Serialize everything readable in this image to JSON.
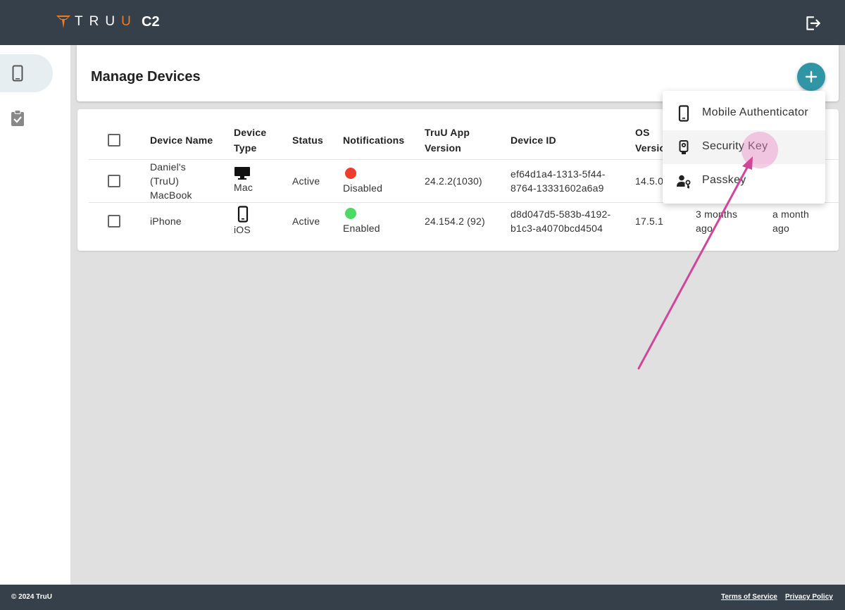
{
  "app": {
    "brand": "TRUU",
    "name": "C2"
  },
  "colors": {
    "topbar": "#36404a",
    "accent": "#2f96a8",
    "brand_orange": "#f07a22",
    "status_disabled": "#ee3d2a",
    "status_enabled": "#4cd964",
    "annotation": "#d1459a"
  },
  "sidebar": {
    "items": [
      {
        "icon": "smartphone-icon",
        "active": true
      },
      {
        "icon": "clipboard-check-icon",
        "active": false
      }
    ]
  },
  "page": {
    "title": "Manage Devices",
    "add_icon": "plus-icon"
  },
  "table": {
    "headers": {
      "name": "Device Name",
      "type_l1": "Device",
      "type_l2": "Type",
      "status": "Status",
      "notifications": "Notifications",
      "version_l1": "TruU App",
      "version_l2": "Version",
      "device_id": "Device ID",
      "os_l1": "OS",
      "os_l2": "Versio"
    },
    "rows": [
      {
        "name_l1": "Daniel's",
        "name_l2": "(TruU)",
        "name_l3": "MacBook",
        "type_icon": "desktop-icon",
        "type": "Mac",
        "status": "Active",
        "notification": "Disabled",
        "notification_color": "#ee3d2a",
        "app_version": "24.2.2(1030)",
        "id_l1": "ef64d1a4-1313-5f44-",
        "id_l2": "8764-13331602a6a9",
        "os": "14.5.0"
      },
      {
        "name_l1": "iPhone",
        "type_icon": "smartphone-icon",
        "type": "iOS",
        "status": "Active",
        "notification": "Enabled",
        "notification_color": "#4cd964",
        "app_version": "24.154.2 (92)",
        "id_l1": "d8d047d5-583b-4192-",
        "id_l2": "b1c3-a4070bcd4504",
        "os": "17.5.1",
        "col7_l1": "3 months",
        "col7_l2": "ago",
        "col8_l1": "a month",
        "col8_l2": "ago"
      }
    ]
  },
  "menu": {
    "items": [
      {
        "label": "Mobile Authenticator",
        "icon": "smartphone-icon"
      },
      {
        "label": "Security Key",
        "icon": "security-key-icon"
      },
      {
        "label": "Passkey",
        "icon": "user-key-icon"
      }
    ]
  },
  "footer": {
    "copyright": "© 2024 TruU",
    "terms": "Terms of Service",
    "privacy": "Privacy Policy"
  }
}
